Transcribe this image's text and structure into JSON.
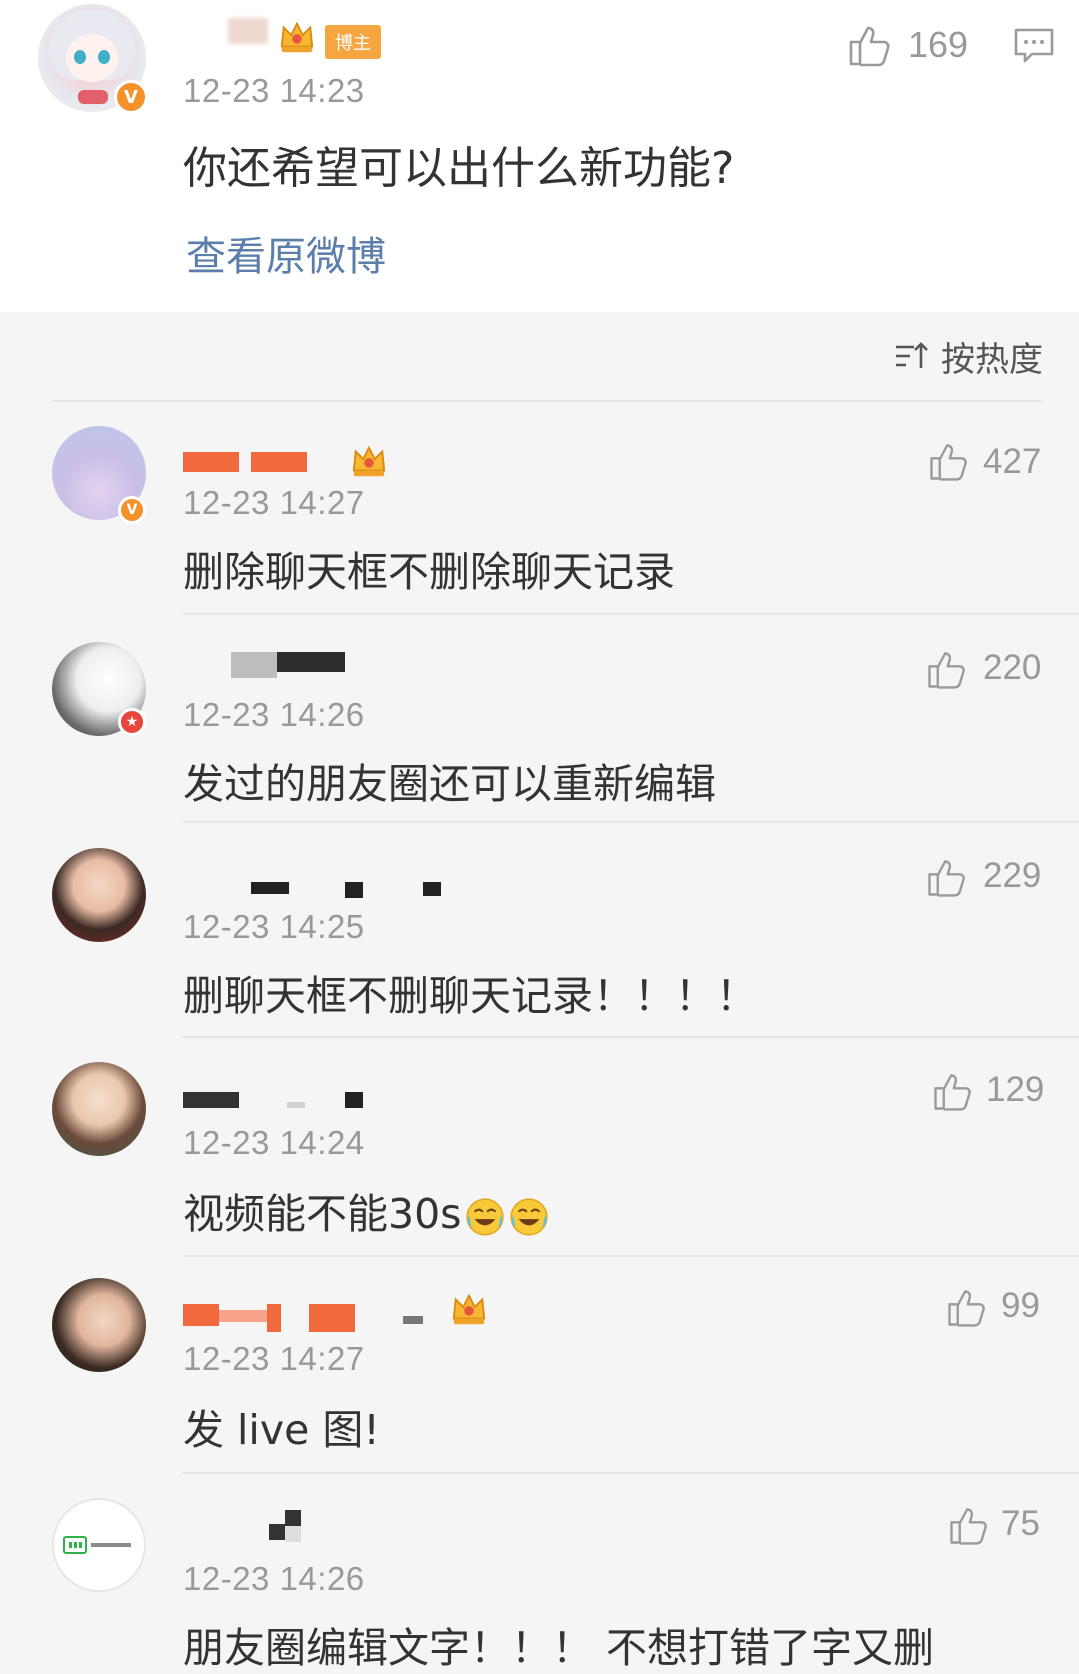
{
  "post": {
    "badge_label": "博主",
    "time": "12-23 14:23",
    "like_count": "169",
    "text": "你还希望可以出什么新功能?",
    "view_original": "查看原微博"
  },
  "sort": {
    "label": "按热度"
  },
  "comments": [
    {
      "time": "12-23 14:27",
      "text": "删除聊天框不删除聊天记录",
      "likes": "427"
    },
    {
      "time": "12-23 14:26",
      "text": "发过的朋友圈还可以重新编辑",
      "likes": "220"
    },
    {
      "time": "12-23 14:25",
      "text": "删聊天框不删聊天记录！！！！",
      "likes": "229"
    },
    {
      "time": "12-23 14:24",
      "text": "视频能不能30s",
      "likes": "129"
    },
    {
      "time": "12-23 14:27",
      "text": "发 live 图!",
      "likes": "99"
    },
    {
      "time": "12-23 14:26",
      "text": "朋友圈编辑文字！！！ 不想打错了字又删",
      "likes": "75"
    }
  ],
  "colors": {
    "accent_link": "#5b7eaa",
    "verified_orange": "#f3912a",
    "blogger_tag": "#f6a640",
    "redacted_orange": "#f16a3d"
  },
  "icons": [
    "thumbs-up-icon",
    "comment-icon",
    "crown-icon",
    "sort-icon",
    "verified-badge-icon",
    "laughing-tears-emoji-icon"
  ]
}
